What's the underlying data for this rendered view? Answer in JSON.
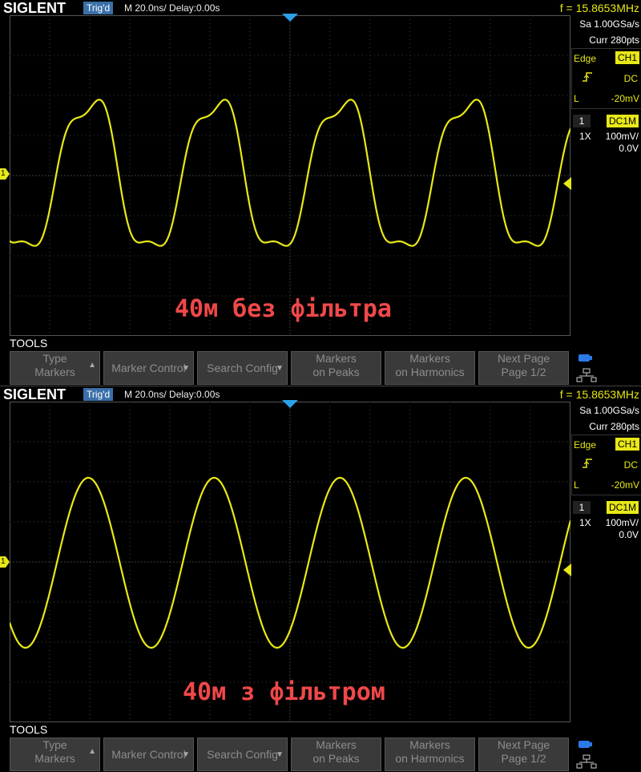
{
  "colors": {
    "trace": "#e8e818",
    "grid": "#3c3c3c",
    "overlay": "#f04848",
    "softkey_bg": "#3a3a3a"
  },
  "screens": [
    {
      "logo": "SIGLENT",
      "trig_status": "Trig'd",
      "timebase": "M 20.0ns/  Delay:0.00s",
      "frequency": "f = 15.8653MHz",
      "sample_rate": "Sa 1.00GSa/s",
      "curr_pts": "Curr 280pts",
      "trigger": {
        "type": "Edge",
        "source": "CH1",
        "coupling": "DC",
        "level_label": "L",
        "level": "-20mV",
        "slope_icon": "rising-edge-icon"
      },
      "channel": {
        "num": "1",
        "coupling": "DC1M",
        "probe": "1X",
        "vdiv": "100mV/",
        "offset": "0.0V"
      },
      "ch_marker": "1",
      "overlay_text": "40м без фільтра",
      "trace_style": "distorted",
      "tools_label": "TOOLS",
      "softkeys": [
        {
          "l1": "Type",
          "l2": "Markers",
          "arrow": "up-arrow-icon"
        },
        {
          "l1": "Marker Control",
          "l2": "",
          "arrow": "down-arrow-icon"
        },
        {
          "l1": "Search Config",
          "l2": "",
          "arrow": "down-arrow-icon"
        },
        {
          "l1": "Markers",
          "l2": "on Peaks",
          "arrow": ""
        },
        {
          "l1": "Markers",
          "l2": "on Harmonics",
          "arrow": ""
        },
        {
          "l1": "Next Page",
          "l2": "Page 1/2",
          "arrow": ""
        }
      ]
    },
    {
      "logo": "SIGLENT",
      "trig_status": "Trig'd",
      "timebase": "M 20.0ns/  Delay:0.00s",
      "frequency": "f = 15.8653MHz",
      "sample_rate": "Sa 1.00GSa/s",
      "curr_pts": "Curr 280pts",
      "trigger": {
        "type": "Edge",
        "source": "CH1",
        "coupling": "DC",
        "level_label": "L",
        "level": "-20mV",
        "slope_icon": "rising-edge-icon"
      },
      "channel": {
        "num": "1",
        "coupling": "DC1M",
        "probe": "1X",
        "vdiv": "100mV/",
        "offset": "0.0V"
      },
      "ch_marker": "1",
      "overlay_text": "40м з фільтром",
      "trace_style": "clean",
      "tools_label": "TOOLS",
      "softkeys": [
        {
          "l1": "Type",
          "l2": "Markers",
          "arrow": "up-arrow-icon"
        },
        {
          "l1": "Marker Control",
          "l2": "",
          "arrow": "down-arrow-icon"
        },
        {
          "l1": "Search Config",
          "l2": "",
          "arrow": "down-arrow-icon"
        },
        {
          "l1": "Markers",
          "l2": "on Peaks",
          "arrow": ""
        },
        {
          "l1": "Markers",
          "l2": "on Harmonics",
          "arrow": ""
        },
        {
          "l1": "Next Page",
          "l2": "Page 1/2",
          "arrow": ""
        }
      ]
    }
  ]
}
